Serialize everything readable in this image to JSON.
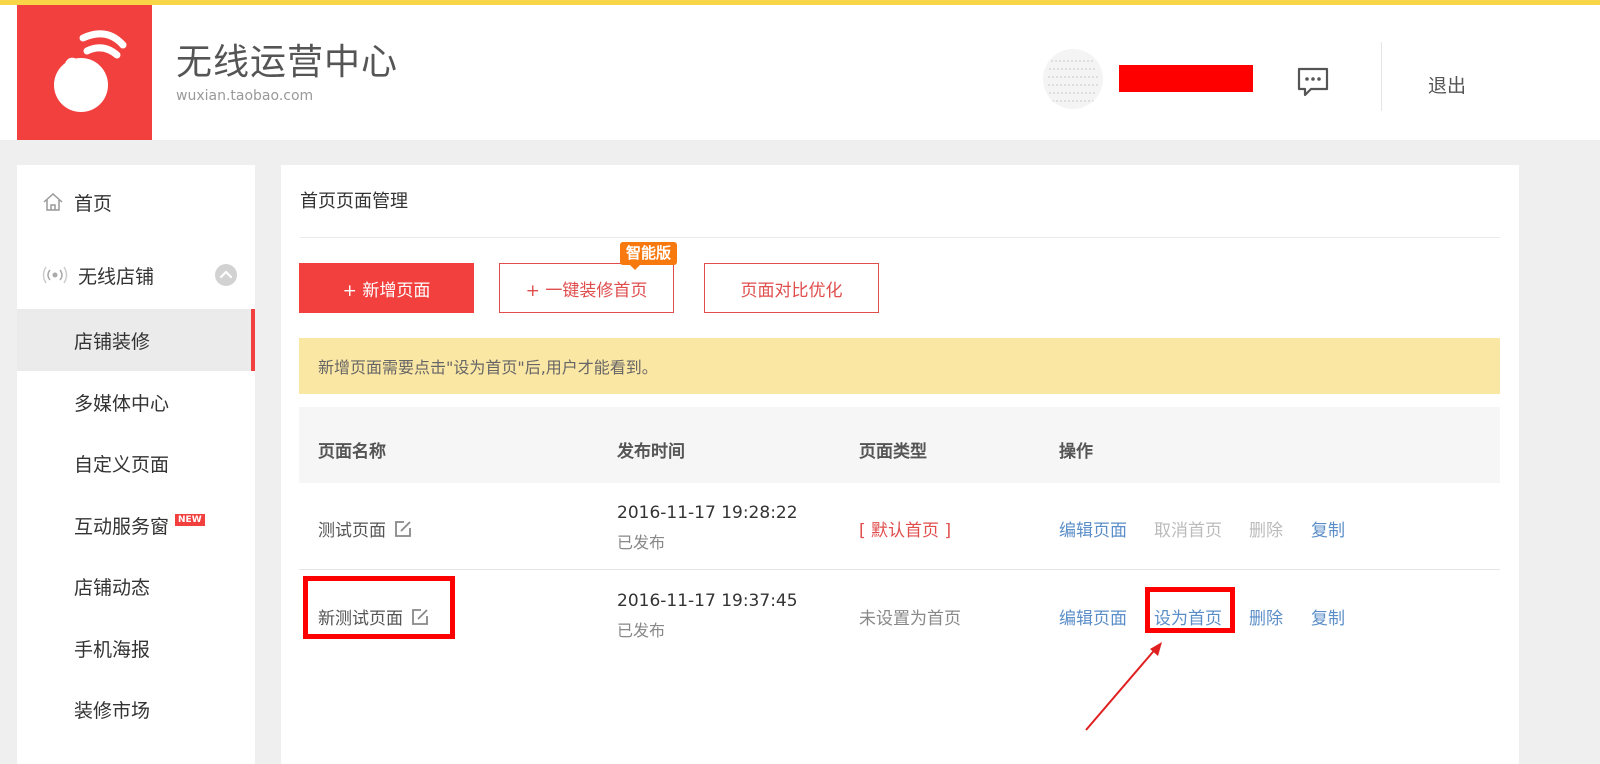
{
  "header": {
    "brand_title": "无线运营中心",
    "brand_sub": "wuxian.taobao.com",
    "logout": "退出"
  },
  "sidebar": {
    "home": "首页",
    "group": "无线店铺",
    "items": [
      {
        "label": "店铺装修",
        "active": true
      },
      {
        "label": "多媒体中心"
      },
      {
        "label": "自定义页面"
      },
      {
        "label": "互动服务窗",
        "badge": "NEW"
      },
      {
        "label": "店铺动态"
      },
      {
        "label": "手机海报"
      },
      {
        "label": "装修市场"
      }
    ]
  },
  "main": {
    "title": "首页页面管理",
    "buttons": {
      "add_page": "+ 新增页面",
      "one_key": "+ 一键装修首页",
      "one_key_tag": "智能版",
      "compare": "页面对比优化"
    },
    "notice": "新增页面需要点击\"设为首页\"后,用户才能看到。",
    "table": {
      "headers": [
        "页面名称",
        "发布时间",
        "页面类型",
        "操作"
      ],
      "rows": [
        {
          "name": "测试页面",
          "time": "2016-11-17 19:28:22",
          "status": "已发布",
          "type": "[ 默认首页 ]",
          "actions": [
            "编辑页面",
            "取消首页",
            "删除",
            "复制"
          ]
        },
        {
          "name": "新测试页面",
          "time": "2016-11-17 19:37:45",
          "status": "已发布",
          "type": "未设置为首页",
          "actions": [
            "编辑页面",
            "设为首页",
            "删除",
            "复制"
          ]
        }
      ]
    }
  },
  "colors": {
    "brand_red": "#f2403f",
    "top_line": "#f9d648",
    "notice_bg": "#fbe7a4",
    "link_blue": "#5b8ec8",
    "tag_orange": "#f87a0e"
  }
}
